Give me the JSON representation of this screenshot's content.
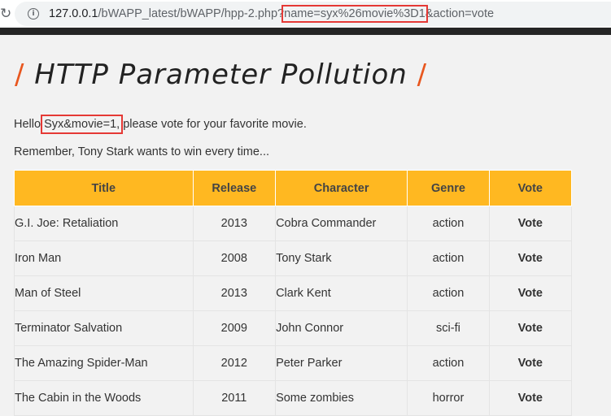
{
  "browser": {
    "url_main": "127.0.0.1",
    "url_path": "/bWAPP_latest/bWAPP/hpp-2.php?",
    "url_highlight": "name=syx%26movie%3D1",
    "url_tail": "&action=vote",
    "reload_icon": "reload-icon",
    "info_icon": "info-icon"
  },
  "page": {
    "title": "HTTP Parameter Pollution",
    "slash": "/",
    "hello_prefix": "Hello ",
    "hello_name": "Syx&movie=1,",
    "hello_suffix": " please vote for your favorite movie.",
    "remember": "Remember, Tony Stark wants to win every time..."
  },
  "table": {
    "headers": [
      "Title",
      "Release",
      "Character",
      "Genre",
      "Vote"
    ],
    "rows": [
      {
        "title": "G.I. Joe: Retaliation",
        "release": "2013",
        "character": "Cobra Commander",
        "genre": "action",
        "vote": "Vote"
      },
      {
        "title": "Iron Man",
        "release": "2008",
        "character": "Tony Stark",
        "genre": "action",
        "vote": "Vote"
      },
      {
        "title": "Man of Steel",
        "release": "2013",
        "character": "Clark Kent",
        "genre": "action",
        "vote": "Vote"
      },
      {
        "title": "Terminator Salvation",
        "release": "2009",
        "character": "John Connor",
        "genre": "sci-fi",
        "vote": "Vote"
      },
      {
        "title": "The Amazing Spider-Man",
        "release": "2012",
        "character": "Peter Parker",
        "genre": "action",
        "vote": "Vote"
      },
      {
        "title": "The Cabin in the Woods",
        "release": "2011",
        "character": "Some zombies",
        "genre": "horror",
        "vote": "Vote"
      }
    ]
  },
  "colors": {
    "accent_slash": "#e8571f",
    "table_header": "#ffb821",
    "highlight_box": "#e53935"
  }
}
